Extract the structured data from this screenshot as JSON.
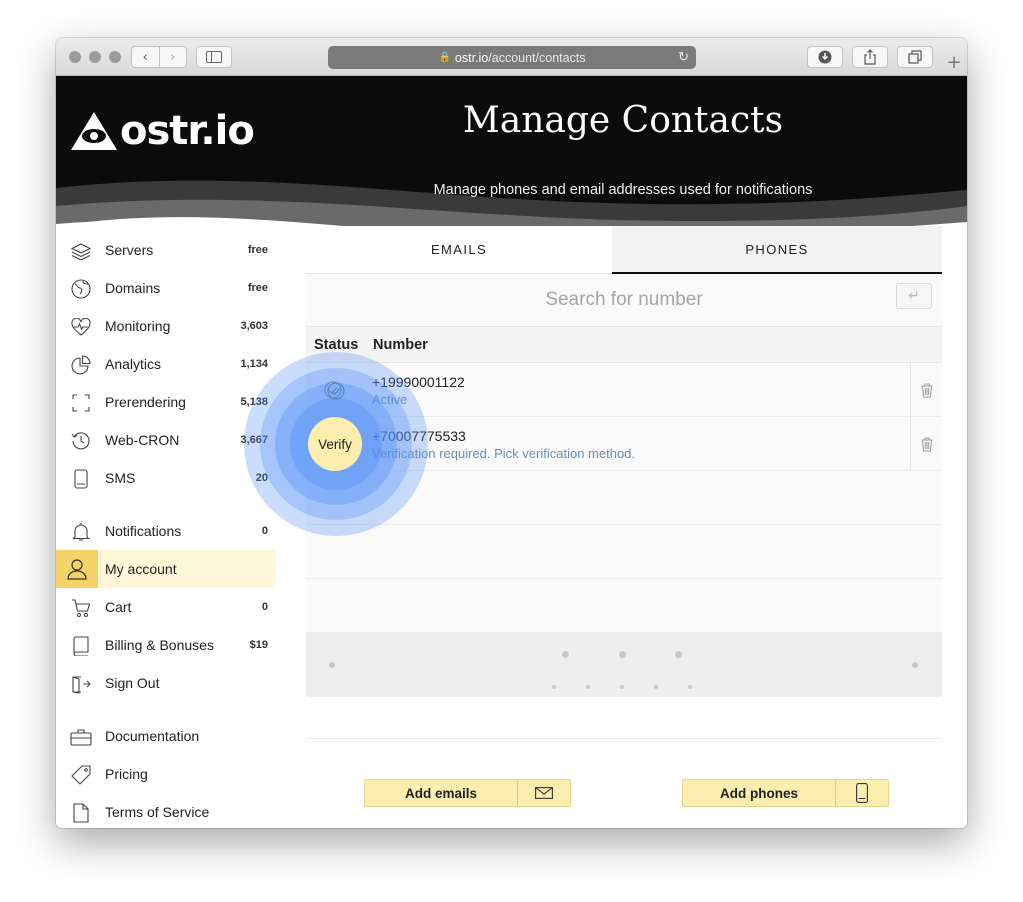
{
  "browser": {
    "address_host": "ostr.io",
    "address_path": "/account/contacts"
  },
  "hero": {
    "logo_text": "ostr.io",
    "title": "Manage Contacts",
    "subtitle": "Manage phones and email addresses used for notifications"
  },
  "sidebar": {
    "items": [
      {
        "label": "Servers",
        "count": "free",
        "icon": "layers-icon"
      },
      {
        "label": "Domains",
        "count": "free",
        "icon": "globe-icon"
      },
      {
        "label": "Monitoring",
        "count": "3,603",
        "icon": "heart-pulse-icon"
      },
      {
        "label": "Analytics",
        "count": "1,134",
        "icon": "pie-chart-icon"
      },
      {
        "label": "Prerendering",
        "count": "5,138",
        "icon": "frame-corners-icon"
      },
      {
        "label": "Web-CRON",
        "count": "3,667",
        "icon": "clock-history-icon"
      },
      {
        "label": "SMS",
        "count": "20",
        "icon": "phone-icon"
      },
      {
        "label": "Notifications",
        "count": "0",
        "icon": "bell-icon"
      },
      {
        "label": "My account",
        "count": "",
        "icon": "user-icon"
      },
      {
        "label": "Cart",
        "count": "0",
        "icon": "cart-icon"
      },
      {
        "label": "Billing & Bonuses",
        "count": "$19",
        "icon": "book-icon"
      },
      {
        "label": "Sign Out",
        "count": "",
        "icon": "sign-out-icon"
      },
      {
        "label": "Documentation",
        "count": "",
        "icon": "briefcase-icon"
      },
      {
        "label": "Pricing",
        "count": "",
        "icon": "tag-icon"
      },
      {
        "label": "Terms of Service",
        "count": "",
        "icon": "document-icon"
      }
    ],
    "active": "My account"
  },
  "tabs": {
    "emails": "EMAILS",
    "phones": "PHONES",
    "active": "PHONES"
  },
  "search": {
    "placeholder": "Search for number"
  },
  "table": {
    "headers": {
      "status": "Status",
      "number": "Number"
    },
    "rows": [
      {
        "number": "+19990001122",
        "state": "Active",
        "status_icon": "check-circle-icon"
      },
      {
        "number": "+70007775533",
        "state": "Verification required. Pick verification method.",
        "status_icon": "verify-button"
      }
    ]
  },
  "verify": {
    "label": "Verify"
  },
  "actions": {
    "add_emails": "Add emails",
    "add_phones": "Add phones"
  },
  "colors": {
    "accent_yellow": "#fbeeaf",
    "active_icon_bg": "#f5d36a",
    "status_blue": "#6a8fb4",
    "hero_bg": "#0b0b0b",
    "ripple_blue": "#4f8ff7"
  }
}
